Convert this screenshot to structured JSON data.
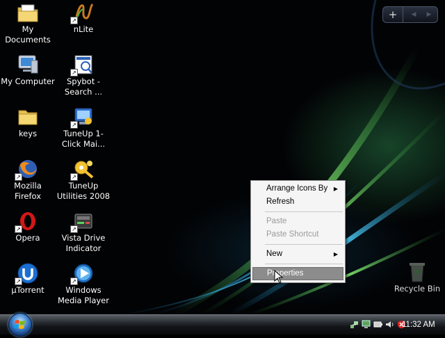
{
  "desktop": {
    "icons": [
      {
        "label": "My Documents",
        "icon": "folder-documents-icon"
      },
      {
        "label": "nLite",
        "icon": "nlite-icon"
      },
      {
        "label": "My Computer",
        "icon": "computer-icon"
      },
      {
        "label": "Spybot - Search ...",
        "icon": "spybot-icon"
      },
      {
        "label": "keys",
        "icon": "folder-icon"
      },
      {
        "label": "TuneUp 1-Click Mai...",
        "icon": "tuneup-1click-icon"
      },
      {
        "label": "Mozilla Firefox",
        "icon": "firefox-icon"
      },
      {
        "label": "TuneUp Utilities 2008",
        "icon": "tuneup-utilities-icon"
      },
      {
        "label": "Opera",
        "icon": "opera-icon"
      },
      {
        "label": "Vista Drive Indicator",
        "icon": "drive-indicator-icon"
      },
      {
        "label": "µTorrent",
        "icon": "utorrent-icon"
      },
      {
        "label": "Windows Media Player",
        "icon": "media-player-icon"
      }
    ],
    "recycle_bin": {
      "label": "Recycle Bin",
      "icon": "recycle-bin-icon"
    }
  },
  "sidebar_gadget": {
    "add_label": "+",
    "prev_label": "◀",
    "next_label": "▶"
  },
  "context_menu": {
    "items": [
      {
        "label": "Arrange Icons By",
        "submenu": true,
        "enabled": true
      },
      {
        "label": "Refresh",
        "submenu": false,
        "enabled": true
      },
      {
        "label": "Paste",
        "submenu": false,
        "enabled": false
      },
      {
        "label": "Paste Shortcut",
        "submenu": false,
        "enabled": false
      },
      {
        "label": "New",
        "submenu": true,
        "enabled": true
      },
      {
        "label": "Properties",
        "submenu": false,
        "enabled": true,
        "selected": true
      }
    ],
    "submenu_arrow": "▶"
  },
  "taskbar": {
    "start_icon": "windows-logo-icon",
    "tray_icons": [
      "network-icon",
      "monitor-icon",
      "battery-icon",
      "speaker-icon",
      "security-shield-icon"
    ],
    "clock": "11:32 AM"
  },
  "colors": {
    "menu_bg": "#f5f5f5",
    "menu_selected": "#8c8c8c",
    "taskbar_dark": "#0a0b0d",
    "wallpaper_green": "#35c24a",
    "wallpaper_blue": "#2aa6d6"
  }
}
